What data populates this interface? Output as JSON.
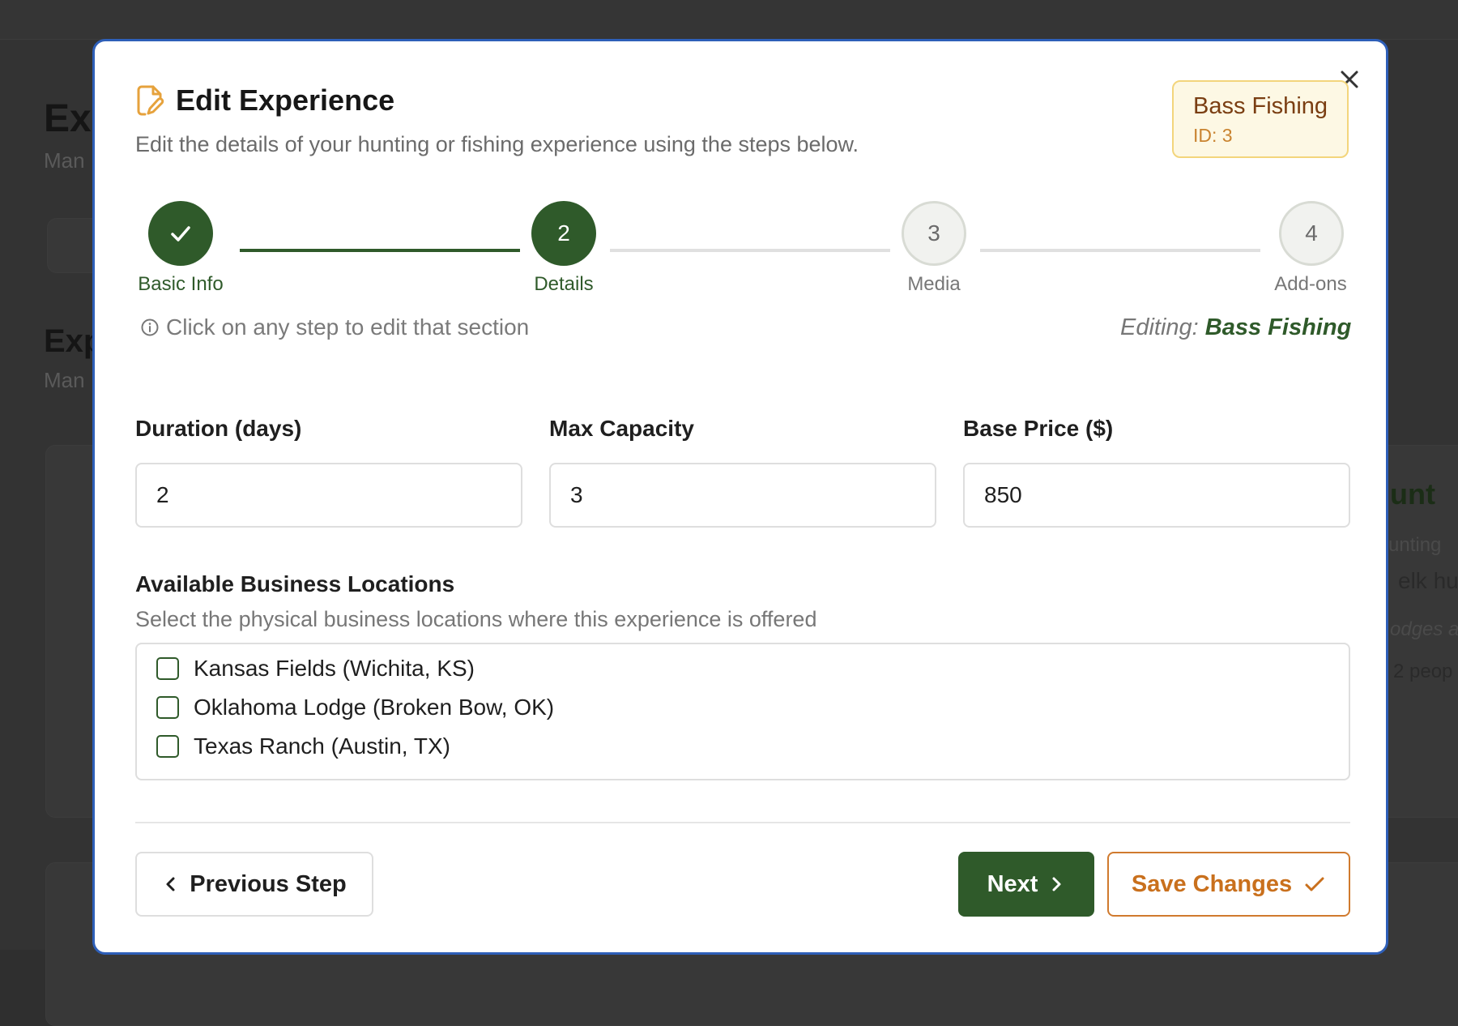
{
  "modal": {
    "title": "Edit Experience",
    "subtitle": "Edit the details of your hunting or fishing experience using the steps below.",
    "badge": {
      "name": "Bass Fishing",
      "id": "ID: 3"
    }
  },
  "stepper": {
    "steps": [
      {
        "number": "",
        "label": "Basic Info",
        "state": "completed"
      },
      {
        "number": "2",
        "label": "Details",
        "state": "active"
      },
      {
        "number": "3",
        "label": "Media",
        "state": "upcoming"
      },
      {
        "number": "4",
        "label": "Add-ons",
        "state": "upcoming"
      }
    ],
    "hint": "Click on any step to edit that section",
    "editing_prefix": "Editing:",
    "editing_name": "Bass Fishing"
  },
  "fields": {
    "duration": {
      "label": "Duration (days)",
      "value": "2"
    },
    "capacity": {
      "label": "Max Capacity",
      "value": "3"
    },
    "price": {
      "label": "Base Price ($)",
      "value": "850"
    }
  },
  "locations": {
    "label": "Available Business Locations",
    "description": "Select the physical business locations where this experience is offered",
    "options": [
      {
        "label": "Kansas Fields (Wichita, KS)",
        "checked": false
      },
      {
        "label": "Oklahoma Lodge (Broken Bow, OK)",
        "checked": false
      },
      {
        "label": "Texas Ranch (Austin, TX)",
        "checked": false
      }
    ]
  },
  "footer": {
    "previous_label": "Previous Step",
    "next_label": "Next",
    "save_label": "Save Changes"
  },
  "background": {
    "heading1": "Ex",
    "sub1": "Man",
    "heading2": "Exp",
    "sub2": "Man",
    "card_title": "unt",
    "card_line1": "unting",
    "card_line2": "elk hu",
    "card_line3": "odges a",
    "card_line4": "2 peop"
  },
  "colors": {
    "primary_green": "#2f5a2a",
    "accent_orange": "#c9701d",
    "modal_border": "#2e5fb8",
    "badge_bg": "#fdf8e4"
  }
}
